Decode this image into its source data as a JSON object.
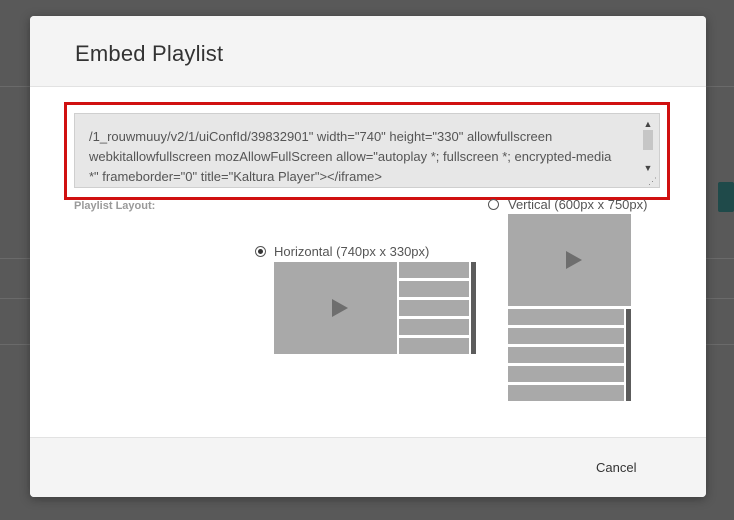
{
  "dialog": {
    "title": "Embed Playlist",
    "embed_code": "/1_rouwmuuy/v2/1/uiConfId/39832901\" width=\"740\" height=\"330\" allowfullscreen webkitallowfullscreen mozAllowFullScreen allow=\"autoplay *; fullscreen *; encrypted-media *\" frameborder=\"0\" title=\"Kaltura Player\"></iframe>",
    "layout_label": "Playlist Layout:",
    "layouts": [
      {
        "label": "Vertical (600px x 750px)",
        "selected": false
      },
      {
        "label": "Horizontal (740px x 330px)",
        "selected": true
      }
    ],
    "cancel_label": "Cancel"
  },
  "colors": {
    "highlight_border": "#d01010",
    "preview_gray": "#a9a9a9",
    "overlay": "#595959"
  }
}
